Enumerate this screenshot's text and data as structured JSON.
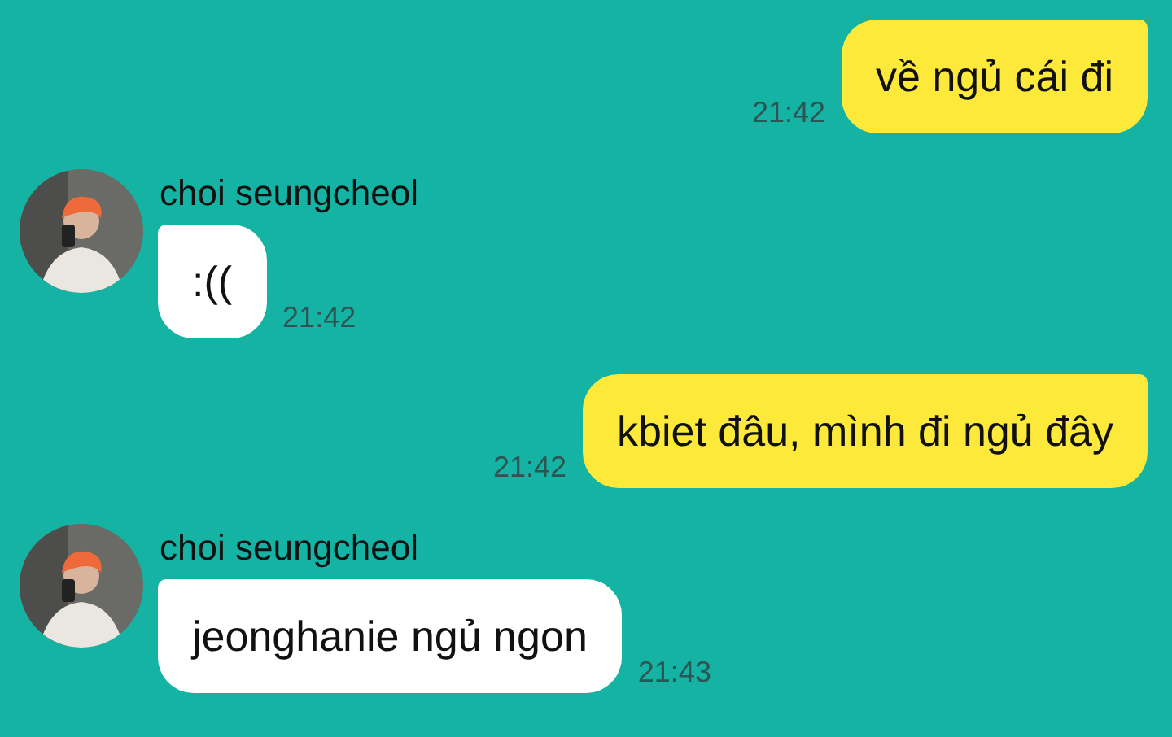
{
  "messages": [
    {
      "kind": "outgoing",
      "text": "về ngủ cái đi",
      "time": "21:42"
    },
    {
      "kind": "incoming",
      "sender": "choi seungcheol",
      "text": ":((",
      "time": "21:42"
    },
    {
      "kind": "outgoing",
      "text": "kbiet đâu, mình đi ngủ đây",
      "time": "21:42"
    },
    {
      "kind": "incoming",
      "sender": "choi seungcheol",
      "text": "jeonghanie ngủ ngon",
      "time": "21:43"
    }
  ]
}
